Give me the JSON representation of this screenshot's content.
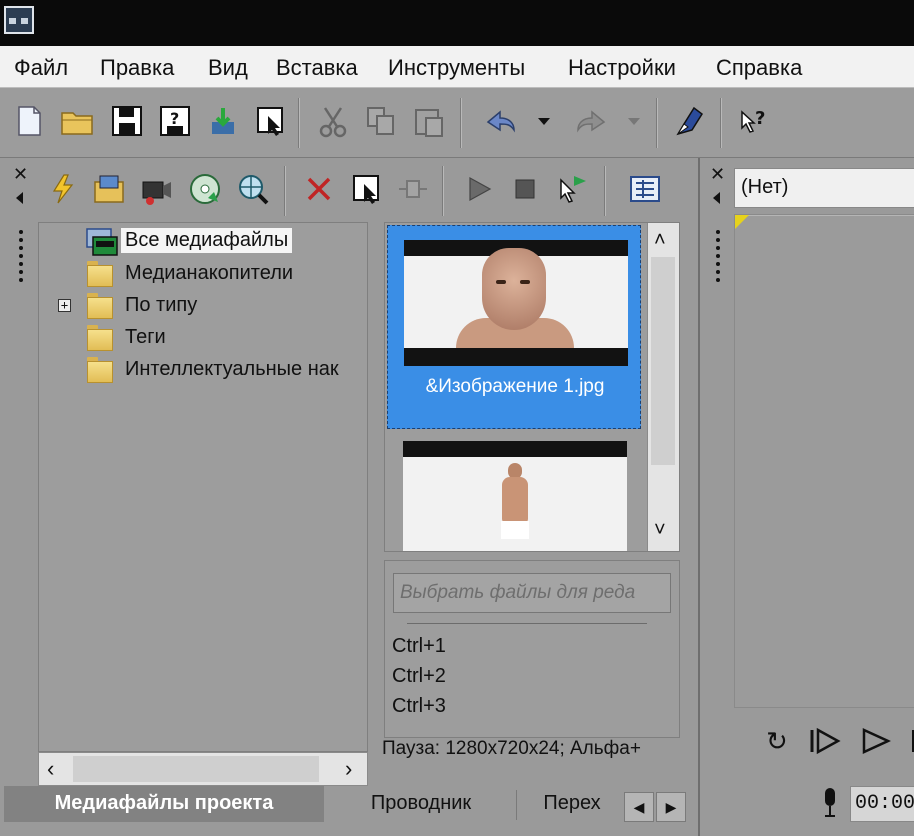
{
  "menubar": {
    "items": [
      "Файл",
      "Правка",
      "Вид",
      "Вставка",
      "Инструменты",
      "Настройки",
      "Справка"
    ]
  },
  "toolbar": {
    "icons": [
      "new-project-icon",
      "open-folder-icon",
      "save-icon",
      "save-as-icon",
      "render-icon",
      "properties-icon",
      "cut-icon",
      "copy-icon",
      "paste-icon",
      "undo-icon",
      "redo-icon",
      "edit-tool-icon",
      "whats-this-icon"
    ]
  },
  "media_panel": {
    "tree": [
      {
        "label": "Все медиафайлы",
        "selected": true
      },
      {
        "label": "Медианакопители",
        "selected": false
      },
      {
        "label": "По типу",
        "selected": false,
        "expandable": true
      },
      {
        "label": "Теги",
        "selected": false
      },
      {
        "label": "Интеллектуальные нак",
        "selected": false
      }
    ],
    "thumbnails": [
      {
        "caption": "&Изображение 1.jpg",
        "selected": true
      },
      {
        "caption": "",
        "selected": false
      }
    ],
    "filter_placeholder": "Выбрать файлы для реда",
    "shortcuts": [
      "Ctrl+1",
      "Ctrl+2",
      "Ctrl+3"
    ],
    "status": "Пауза: 1280x720x24; Альфа+"
  },
  "bottom_tabs": {
    "items": [
      "Медиафайлы проекта",
      "Проводник",
      "Перех"
    ],
    "active_index": 0
  },
  "preview_panel": {
    "selector_value": "(Нет)",
    "timecode": "00:00:"
  },
  "colors": {
    "selection_blue": "#3a8ee6",
    "panel_gray": "#9a9a9a",
    "menubar_bg": "#f2f2f2",
    "titlebar_bg": "#0a0a0a"
  }
}
